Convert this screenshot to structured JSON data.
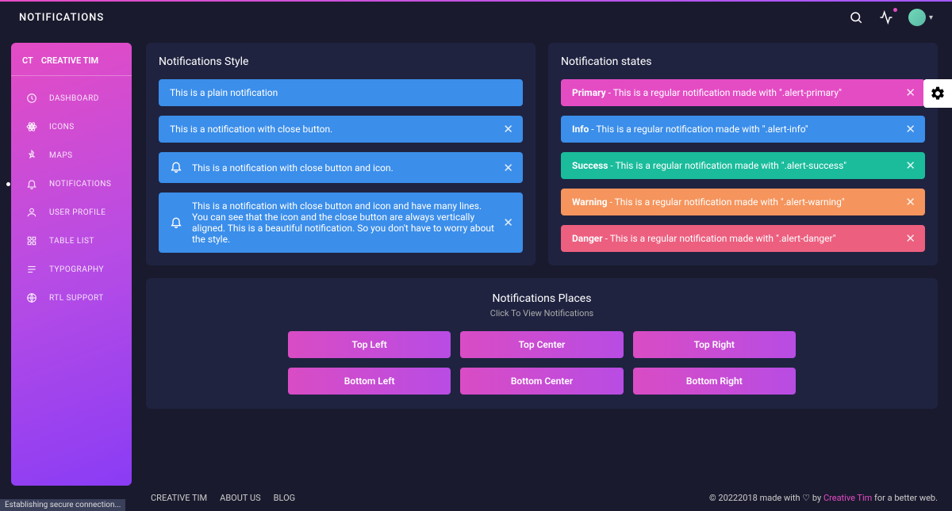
{
  "header": {
    "title": "NOTIFICATIONS"
  },
  "sidebar": {
    "brand_short": "CT",
    "brand_name": "CREATIVE TIM",
    "items": [
      {
        "icon": "dashboard",
        "label": "DASHBOARD"
      },
      {
        "icon": "atom",
        "label": "ICONS"
      },
      {
        "icon": "pin",
        "label": "MAPS"
      },
      {
        "icon": "bell",
        "label": "NOTIFICATIONS",
        "active": true
      },
      {
        "icon": "user",
        "label": "USER PROFILE"
      },
      {
        "icon": "puzzle",
        "label": "TABLE LIST"
      },
      {
        "icon": "text",
        "label": "TYPOGRAPHY"
      },
      {
        "icon": "globe",
        "label": "RTL SUPPORT"
      }
    ]
  },
  "cards": {
    "style_title": "Notifications Style",
    "states_title": "Notification states",
    "style_alerts": [
      {
        "text": "This is a plain notification",
        "close": false,
        "icon": false
      },
      {
        "text": "This is a notification with close button.",
        "close": true,
        "icon": false
      },
      {
        "text": "This is a notification with close button and icon.",
        "close": true,
        "icon": true
      },
      {
        "text": "This is a notification with close button and icon and have many lines. You can see that the icon and the close button are always vertically aligned. This is a beautiful notification. So you don't have to worry about the style.",
        "close": true,
        "icon": true
      }
    ],
    "state_alerts": [
      {
        "bold": "Primary",
        "text": " - This is a regular notification made with \".alert-primary\"",
        "cls": "alert-primary"
      },
      {
        "bold": "Info",
        "text": " - This is a regular notification made with \".alert-info\"",
        "cls": "alert-info"
      },
      {
        "bold": "Success",
        "text": " - This is a regular notification made with \".alert-success\"",
        "cls": "alert-success"
      },
      {
        "bold": "Warning",
        "text": " - This is a regular notification made with \".alert-warning\"",
        "cls": "alert-warning"
      },
      {
        "bold": "Danger",
        "text": " - This is a regular notification made with \".alert-danger\"",
        "cls": "alert-danger"
      }
    ]
  },
  "places": {
    "title": "Notifications Places",
    "subtitle": "Click To View Notifications",
    "buttons": [
      "Top Left",
      "Top Center",
      "Top Right",
      "Bottom Left",
      "Bottom Center",
      "Bottom Right"
    ]
  },
  "footer": {
    "links": [
      "CREATIVE TIM",
      "ABOUT US",
      "BLOG"
    ],
    "copy_prefix": "© 20222018 made with ",
    "copy_mid": " by ",
    "copy_brand": "Creative Tim",
    "copy_suffix": " for a better web."
  },
  "status": "Establishing secure connection..."
}
